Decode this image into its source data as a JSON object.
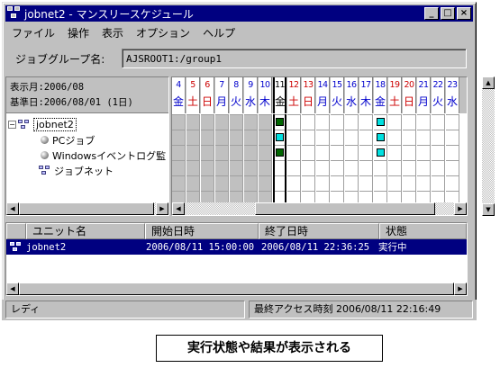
{
  "window": {
    "title": "jobnet2 - マンスリースケジュール",
    "min_label": "_",
    "max_label": "□",
    "close_label": "×"
  },
  "menu": [
    "ファイル",
    "操作",
    "表示",
    "オプション",
    "ヘルプ"
  ],
  "group": {
    "label": "ジョブグループ名:",
    "value": "AJSROOT1:/group1"
  },
  "info": {
    "display_month": "表示月:2006/08",
    "base_day": "基準日:2006/08/01 (1日)"
  },
  "tree": {
    "root": "jobnet2",
    "children": [
      "PCジョブ",
      "Windowsイベントログ監",
      "ジョブネット"
    ]
  },
  "calendar": {
    "days": [
      {
        "n": "4",
        "w": "金",
        "c": "#0000cc"
      },
      {
        "n": "5",
        "w": "土",
        "c": "#cc0000"
      },
      {
        "n": "6",
        "w": "日",
        "c": "#cc0000"
      },
      {
        "n": "7",
        "w": "月",
        "c": "#0000cc"
      },
      {
        "n": "8",
        "w": "火",
        "c": "#0000cc"
      },
      {
        "n": "9",
        "w": "水",
        "c": "#0000cc"
      },
      {
        "n": "10",
        "w": "木",
        "c": "#0000cc"
      },
      {
        "n": "11",
        "w": "金",
        "c": "#000000"
      },
      {
        "n": "12",
        "w": "土",
        "c": "#cc0000"
      },
      {
        "n": "13",
        "w": "日",
        "c": "#cc0000"
      },
      {
        "n": "14",
        "w": "月",
        "c": "#0000cc"
      },
      {
        "n": "15",
        "w": "火",
        "c": "#0000cc"
      },
      {
        "n": "16",
        "w": "水",
        "c": "#0000cc"
      },
      {
        "n": "17",
        "w": "木",
        "c": "#0000cc"
      },
      {
        "n": "18",
        "w": "金",
        "c": "#0000cc"
      },
      {
        "n": "19",
        "w": "土",
        "c": "#cc0000"
      },
      {
        "n": "20",
        "w": "日",
        "c": "#cc0000"
      },
      {
        "n": "21",
        "w": "月",
        "c": "#0000cc"
      },
      {
        "n": "22",
        "w": "火",
        "c": "#0000cc"
      },
      {
        "n": "23",
        "w": "水",
        "c": "#0000cc"
      }
    ],
    "today_index": 7,
    "marks": [
      {
        "day": 7,
        "row": 0,
        "color": "#006600"
      },
      {
        "day": 7,
        "row": 1,
        "color": "#00e0e0"
      },
      {
        "day": 7,
        "row": 2,
        "color": "#006600"
      },
      {
        "day": 14,
        "row": 0,
        "color": "#00e0e0"
      },
      {
        "day": 14,
        "row": 1,
        "color": "#00e0e0"
      },
      {
        "day": 14,
        "row": 2,
        "color": "#00e0e0"
      }
    ]
  },
  "list": {
    "headers": [
      "ユニット名",
      "開始日時",
      "終了日時",
      "状態"
    ],
    "row": {
      "unit": "jobnet2",
      "start": "2006/08/11 15:00:00",
      "end": "2006/08/11 22:36:25",
      "status": "実行中"
    }
  },
  "statusbar": {
    "left": "レディ",
    "right": "最終アクセス時刻 2006/08/11 22:16:49"
  },
  "caption": "実行状態や結果が表示される"
}
